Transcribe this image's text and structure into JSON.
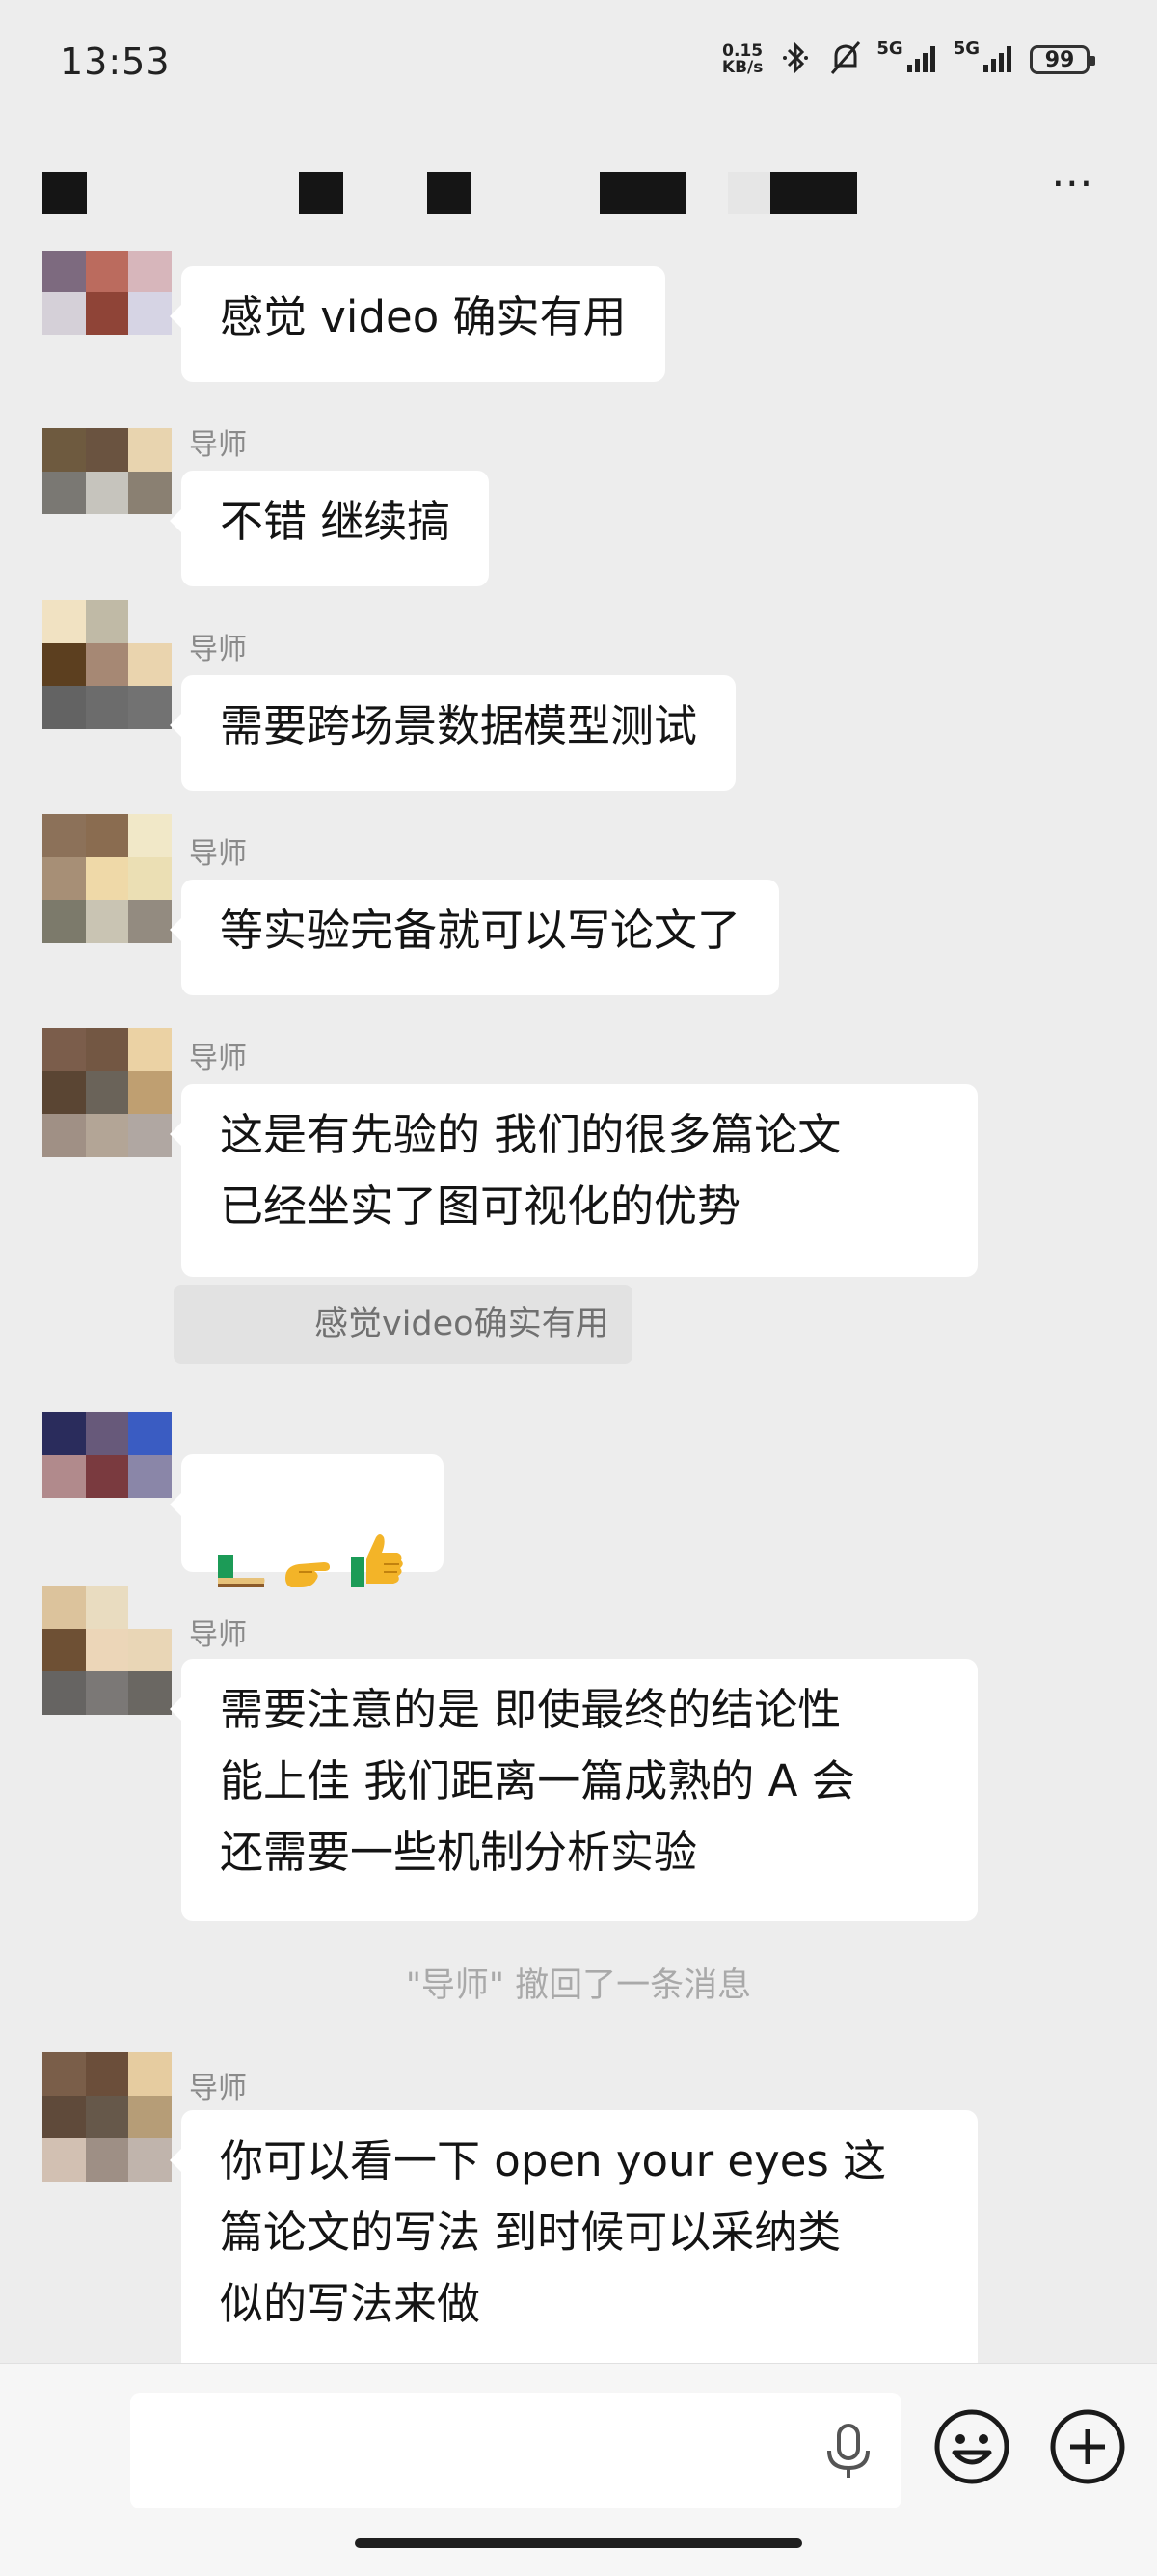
{
  "status_bar": {
    "time": "13:53",
    "net_speed_value": "0.15",
    "net_speed_unit": "KB/s",
    "signal1_label": "5G",
    "signal2_label": "5G",
    "battery": "99",
    "icons": [
      "bluetooth-icon",
      "mute-bell-icon",
      "signal-icon",
      "battery-icon"
    ]
  },
  "header": {
    "more_icon": "⋯"
  },
  "messages": [
    {
      "sender": "",
      "text": "感觉 video 确实有用"
    },
    {
      "sender": "导师",
      "text": "不错 继续搞"
    },
    {
      "sender": "导师",
      "text": "需要跨场景数据模型测试"
    },
    {
      "sender": "导师",
      "text": "等实验完备就可以写论文了"
    },
    {
      "sender": "导师",
      "text": "这是有先验的 我们的很多篇论文\n已经坐实了图可视化的优势",
      "quote": "感觉video确实有用"
    },
    {
      "sender": "",
      "text": "",
      "emoji": [
        "shoe-emoji",
        "pointing-hand-emoji",
        "thumbs-up-emoji"
      ]
    },
    {
      "sender": "导师",
      "text": "需要注意的是 即使最终的结论性\n能上佳 我们距离一篇成熟的 A 会\n还需要一些机制分析实验"
    },
    {
      "sender": "导师",
      "text": "你可以看一下 open your eyes 这\n篇论文的写法 到时候可以采纳类\n似的写法来做"
    }
  ],
  "system_message": "\"导师\" 撤回了一条消息",
  "input_bar": {
    "input_value": "",
    "icons": [
      "voice-mic-icon",
      "emoji-smile-icon",
      "plus-icon"
    ]
  },
  "colors": {
    "background": "#ededed",
    "bubble": "#ffffff",
    "sender_text": "#8a8a8a",
    "system_text": "#a9a9a9"
  }
}
